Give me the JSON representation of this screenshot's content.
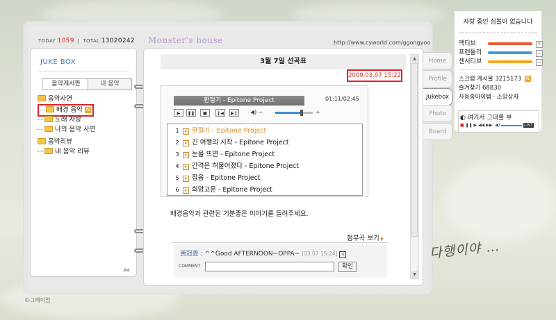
{
  "header": {
    "today_label": "TODAY",
    "today_count": "1059",
    "total_label": "TOTAL",
    "total_count": "13020242",
    "homepage_title": "Monster's house",
    "url": "http://www.cyworld.com/ggongyoo"
  },
  "sidebar": {
    "title": "JUKE BOX",
    "tabs": [
      {
        "label": "음악게시판",
        "active": true
      },
      {
        "label": "내 음악",
        "active": false
      }
    ],
    "tree": [
      {
        "label": "음악사연",
        "level": 0
      },
      {
        "label": "배경 음악",
        "level": 1,
        "selected": true,
        "badge": "N"
      },
      {
        "label": "노래 자랑",
        "level": 1
      },
      {
        "label": "나의 음악 사연",
        "level": 1
      },
      {
        "label": "음악리뷰",
        "level": 0
      },
      {
        "label": "내 음악 리뷰",
        "level": 1
      }
    ]
  },
  "post": {
    "title": "3월 7일 선곡표",
    "date": "2009.03.07 15:22",
    "description": "배경음악과 관련된 기분좋은 이야기를 들려주세요.",
    "attach_label": "첨부곡 보기"
  },
  "player": {
    "now_playing": "환절기 - Epitone Project",
    "time": "01:11/02:45",
    "volume_level": 0.7,
    "controls": [
      "play",
      "pause",
      "stop",
      "prev",
      "next"
    ],
    "tracks": [
      {
        "no": "1",
        "title": "환절기 - Epitone Project",
        "current": true
      },
      {
        "no": "2",
        "title": "긴 여행의 시작 - Epitone Project"
      },
      {
        "no": "3",
        "title": "눈을 뜨면 - Epitone Project"
      },
      {
        "no": "4",
        "title": "간격은 허물어졌다 - Epitone Project"
      },
      {
        "no": "5",
        "title": "잡음 - Epitone Project"
      },
      {
        "no": "6",
        "title": "희망고문 - Epitone Project"
      }
    ]
  },
  "comments": {
    "items": [
      {
        "author": "黃冠菱",
        "text": " : ^^Good AFTERNOON~OPPA~ ",
        "time": "[03.07 15:24]"
      }
    ],
    "input_label": "COMMENT",
    "submit_label": "확인"
  },
  "side_tabs": [
    {
      "label": "Home",
      "active": false
    },
    {
      "label": "Profile",
      "active": false
    },
    {
      "label": "Jukebox",
      "active": true
    },
    {
      "label": "Photo",
      "active": false
    },
    {
      "label": "Board",
      "active": false
    }
  ],
  "widget": {
    "header": "자랑 중인 심볼이 없습니다",
    "bars": [
      {
        "label": "액티브",
        "color": "#e85c3a",
        "button": "↑"
      },
      {
        "label": "프렌들리",
        "color": "#3aa0dc",
        "button": "−"
      },
      {
        "label": "센서티브",
        "color": "#f2a71f",
        "button": "−"
      }
    ],
    "scrap_text": "스크랩 게시물 3215173",
    "favorites_text": "즐겨찾기 68830",
    "items_text": "사용중아이템 · 소망상자",
    "mini_player_title": "여기서 그대를 부",
    "list_label": "LIST"
  },
  "signature": "다행이야 …",
  "copyright": "©그레이엄"
}
